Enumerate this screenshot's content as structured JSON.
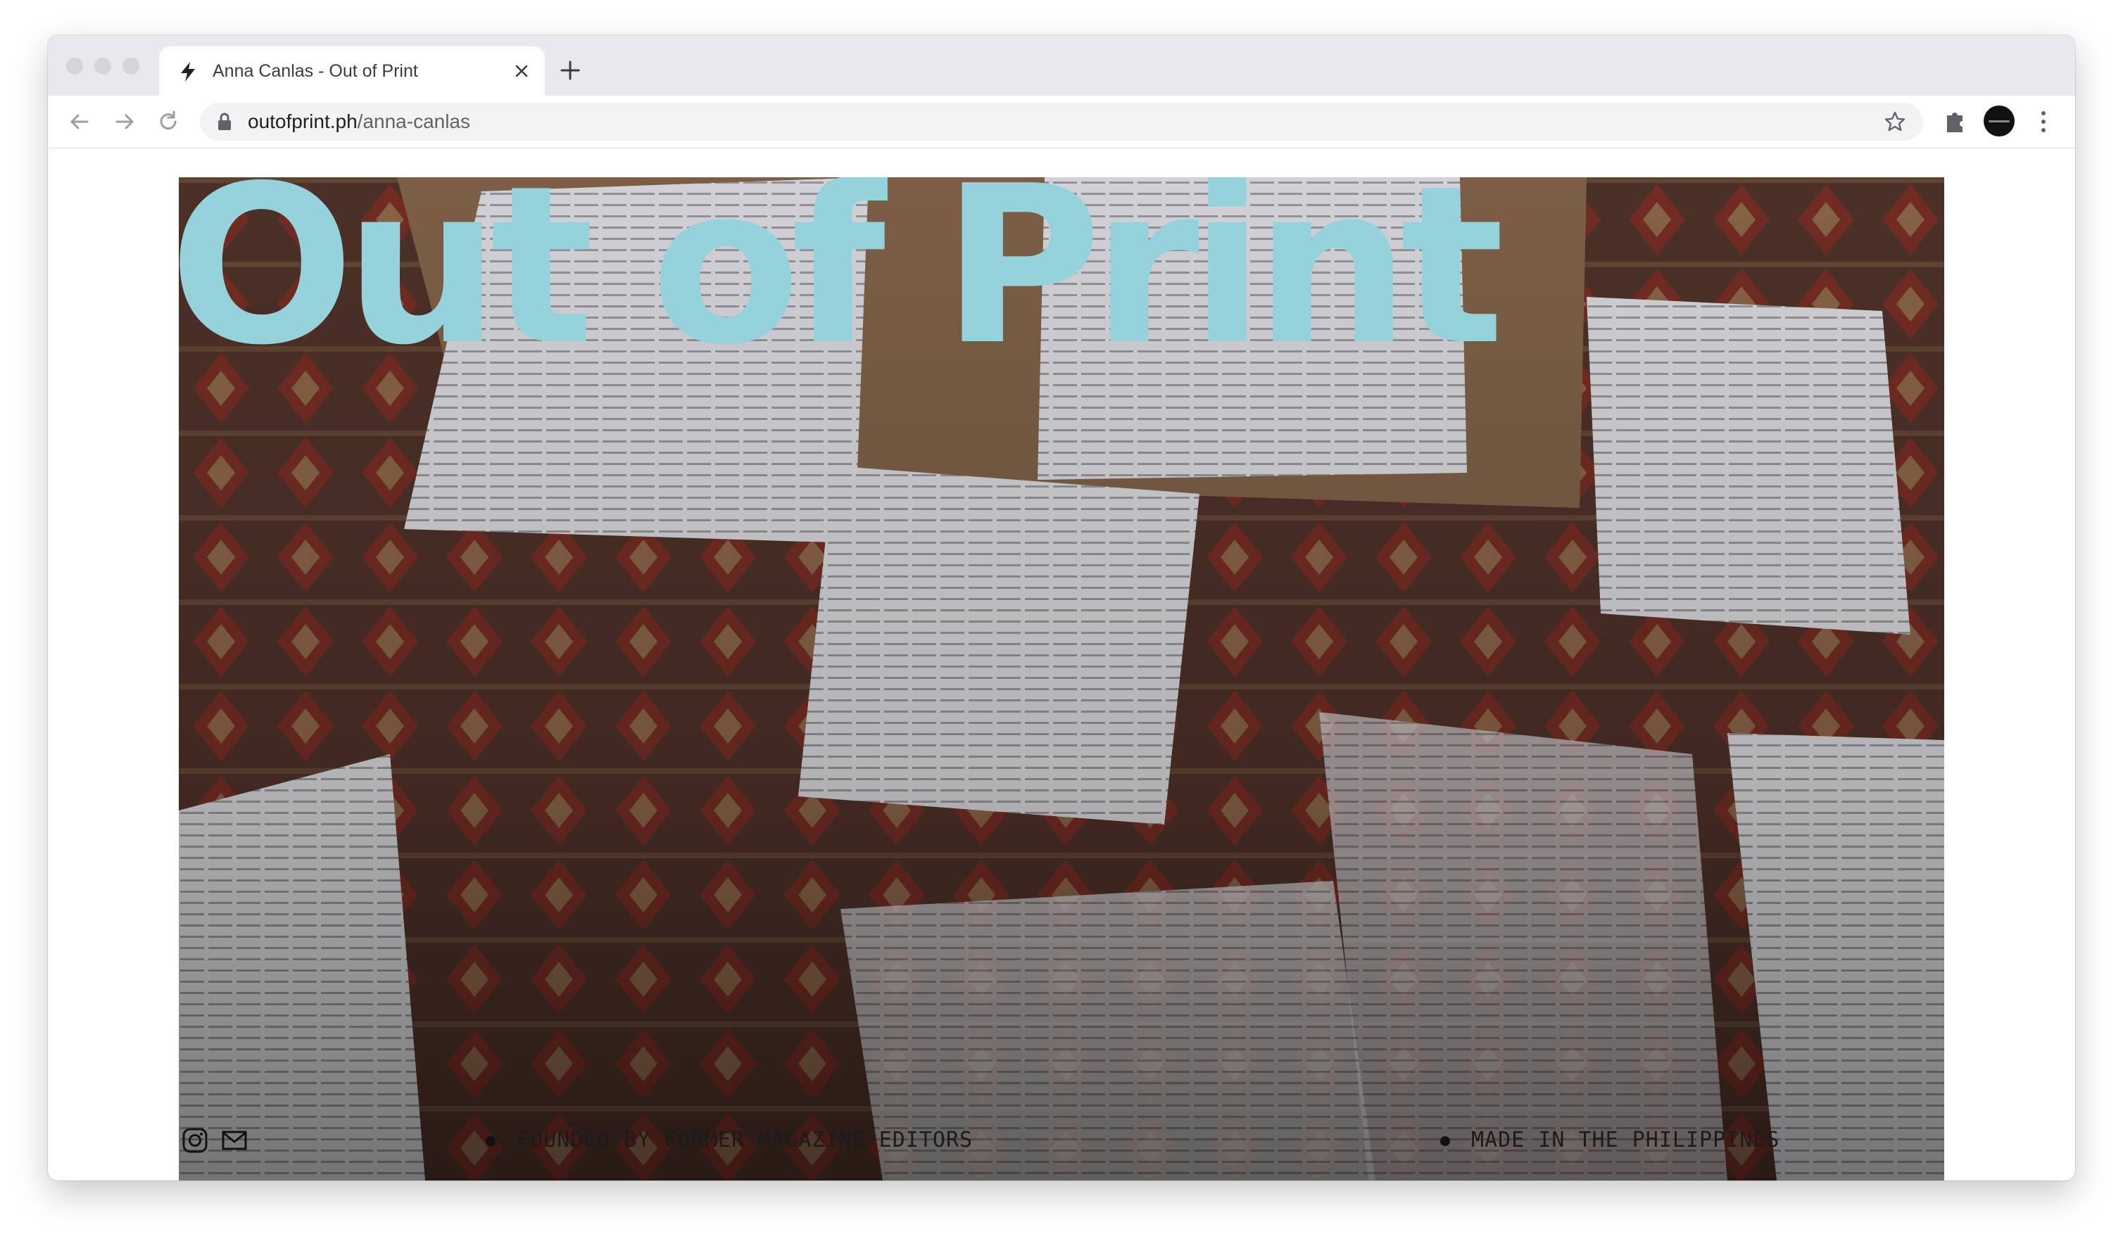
{
  "browser": {
    "tab_title": "Anna Canlas - Out of Print",
    "url_domain": "outofprint.ph",
    "url_path": "/anna-canlas"
  },
  "hero": {
    "title": "Out of Print",
    "title_color": "#96d2dc"
  },
  "footer": {
    "tagline_left": "FOUNDED BY FORMER MAGAZINE EDITORS",
    "tagline_right": "MADE IN THE PHILIPPINES",
    "icons": [
      "instagram-icon",
      "mail-icon"
    ]
  }
}
